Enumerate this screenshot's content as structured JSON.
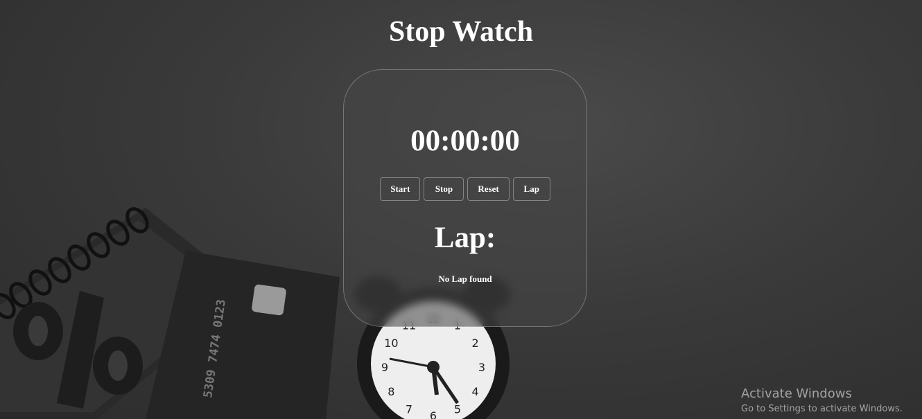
{
  "page": {
    "title": "Stop Watch"
  },
  "stopwatch": {
    "time": "00:00:00",
    "buttons": {
      "start": "Start",
      "stop": "Stop",
      "reset": "Reset",
      "lap": "Lap"
    },
    "lap_heading": "Lap:",
    "lap_empty": "No Lap found"
  },
  "background": {
    "clock_numbers": [
      "12",
      "1",
      "2",
      "3",
      "4",
      "5",
      "6",
      "7",
      "8",
      "9",
      "10",
      "11"
    ],
    "card_text": "5309 7474 0123"
  },
  "os_watermark": {
    "line1": "Activate Windows",
    "line2": "Go to Settings to activate Windows."
  },
  "colors": {
    "text": "#ffffff",
    "background": "#3a3a3a",
    "card_border": "#8a8a8a"
  }
}
